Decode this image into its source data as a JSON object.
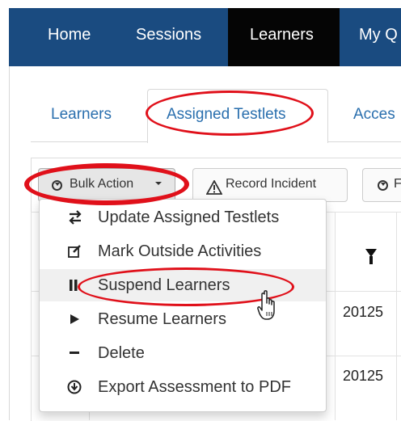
{
  "topnav": {
    "items": [
      {
        "label": "Home",
        "active": false
      },
      {
        "label": "Sessions",
        "active": false
      },
      {
        "label": "Learners",
        "active": true
      },
      {
        "label": "My Q",
        "active": false
      }
    ]
  },
  "tabs": [
    {
      "label": "Learners",
      "active": false
    },
    {
      "label": "Assigned Testlets",
      "active": true
    },
    {
      "label": "Acces",
      "active": false
    }
  ],
  "toolbar": {
    "bulk_action_label": "Bulk Action",
    "record_incident_label": "Record Incident",
    "third_button_label": "F"
  },
  "bulk_menu": {
    "items": [
      {
        "label": "Update Assigned Testlets",
        "icon": "swap-arrows-icon"
      },
      {
        "label": "Mark Outside Activities",
        "icon": "edit-icon"
      },
      {
        "label": "Suspend Learners",
        "icon": "pause-icon",
        "hovered": true
      },
      {
        "label": "Resume Learners",
        "icon": "play-icon"
      },
      {
        "label": "Delete",
        "icon": "minus-icon"
      },
      {
        "label": "Export Assessment to PDF",
        "icon": "download-circle-icon"
      }
    ]
  },
  "table": {
    "rows": [
      {
        "value": "20125"
      },
      {
        "value": "20125"
      }
    ]
  },
  "colors": {
    "nav_bg": "#1a4b80",
    "nav_active_bg": "#050505",
    "link": "#2a6fae",
    "annotation_red": "#e0101a"
  }
}
